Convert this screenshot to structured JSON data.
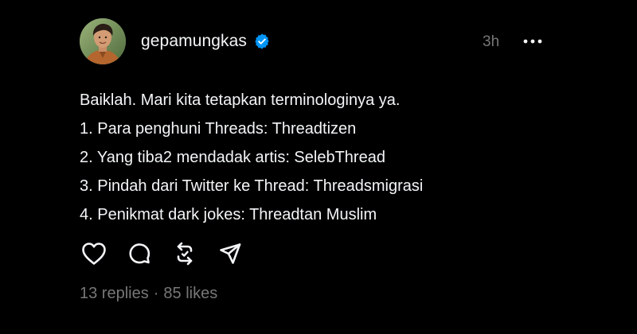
{
  "post": {
    "author": {
      "username": "gepamungkas",
      "verified": true,
      "avatar_icon": "user-avatar"
    },
    "timestamp": "3h",
    "more_icon": "ellipsis-icon",
    "lines": [
      "Baiklah. Mari kita tetapkan terminologinya ya.",
      "1. Para penghuni Threads: Threadtizen",
      "2. Yang tiba2 mendadak artis: SelebThread",
      "3. Pindah dari Twitter ke Thread: Threadsmigrasi",
      "4. Penikmat dark jokes: Threadtan Muslim"
    ],
    "actions": [
      "heart-icon",
      "comment-icon",
      "repost-icon",
      "share-icon"
    ],
    "stats": {
      "replies": "13 replies",
      "separator": "·",
      "likes": "85 likes"
    }
  },
  "colors": {
    "background": "#000000",
    "text": "#f3f5f7",
    "muted": "#777777",
    "verified": "#0095f6"
  }
}
